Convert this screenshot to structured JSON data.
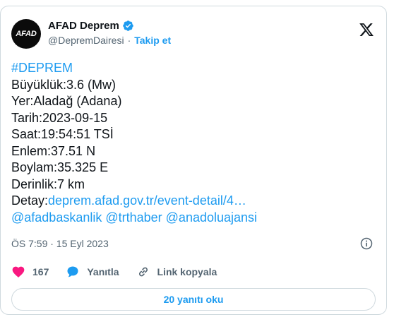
{
  "author": {
    "avatar_text": "AFAD",
    "name": "AFAD Deprem",
    "handle": "@DepremDairesi",
    "separator": "·",
    "follow_label": "Takip et"
  },
  "tweet": {
    "hashtag": "#DEPREM",
    "lines": [
      "Büyüklük:3.6 (Mw)",
      "Yer:Aladağ (Adana)",
      "Tarih:2023-09-15",
      "Saat:19:54:51 TSİ",
      "Enlem:37.51 N",
      "Boylam:35.325 E",
      "Derinlik:7 km"
    ],
    "detail_prefix": "Detay:",
    "detail_link": "deprem.afad.gov.tr/event-detail/4…",
    "mentions": "@afadbaskanlik @trthaber @anadoluajansi"
  },
  "meta": {
    "timestamp": "ÖS 7:59 · 15 Eyl 2023"
  },
  "actions": {
    "like_count": "167",
    "reply_label": "Yanıtla",
    "copy_link_label": "Link kopyala"
  },
  "read_replies_label": "20 yanıtı oku",
  "colors": {
    "accent": "#1d9bf0",
    "like": "#f91880",
    "text": "#0f1419",
    "muted": "#536471",
    "border": "#cfd9de"
  }
}
